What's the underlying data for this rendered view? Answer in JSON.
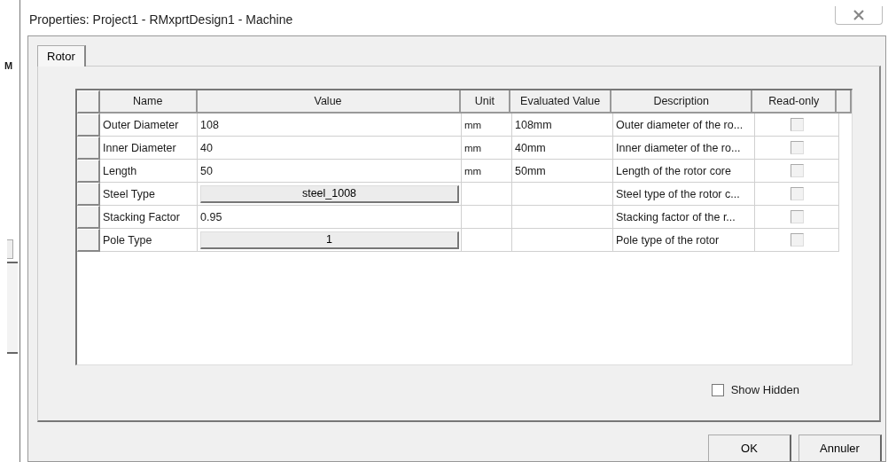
{
  "background_fragment": {
    "label": "M"
  },
  "window": {
    "title": "Properties: Project1 - RMxprtDesign1 - Machine"
  },
  "tabs": [
    {
      "label": "Rotor",
      "selected": true
    }
  ],
  "table": {
    "columns": [
      "Name",
      "Value",
      "Unit",
      "Evaluated Value",
      "Description",
      "Read-only"
    ],
    "rows": [
      {
        "name": "Outer Diameter",
        "value": "108",
        "kind": "text",
        "unit": "mm",
        "evaluated_value": "108mm",
        "description": "Outer diameter of the ro...",
        "read_only": {
          "checked": false,
          "disabled": true
        }
      },
      {
        "name": "Inner Diameter",
        "value": "40",
        "kind": "text",
        "unit": "mm",
        "evaluated_value": "40mm",
        "description": "Inner diameter of the ro...",
        "read_only": {
          "checked": false,
          "disabled": true
        }
      },
      {
        "name": "Length",
        "value": "50",
        "kind": "text",
        "unit": "mm",
        "evaluated_value": "50mm",
        "description": "Length of the rotor core",
        "read_only": {
          "checked": false,
          "disabled": true
        }
      },
      {
        "name": "Steel Type",
        "value": "steel_1008",
        "kind": "button",
        "description": "Steel type of the rotor c...",
        "read_only": {
          "checked": false,
          "disabled": true
        }
      },
      {
        "name": "Stacking Factor",
        "value": "0.95",
        "kind": "text",
        "description": "Stacking factor of the r...",
        "read_only": {
          "checked": false,
          "disabled": true
        }
      },
      {
        "name": "Pole Type",
        "value": "1",
        "kind": "button",
        "description": "Pole type of the rotor",
        "read_only": {
          "checked": false,
          "disabled": true
        }
      }
    ]
  },
  "show_hidden": {
    "label": "Show Hidden",
    "checked": false
  },
  "buttons": [
    "OK",
    "Annuler"
  ]
}
